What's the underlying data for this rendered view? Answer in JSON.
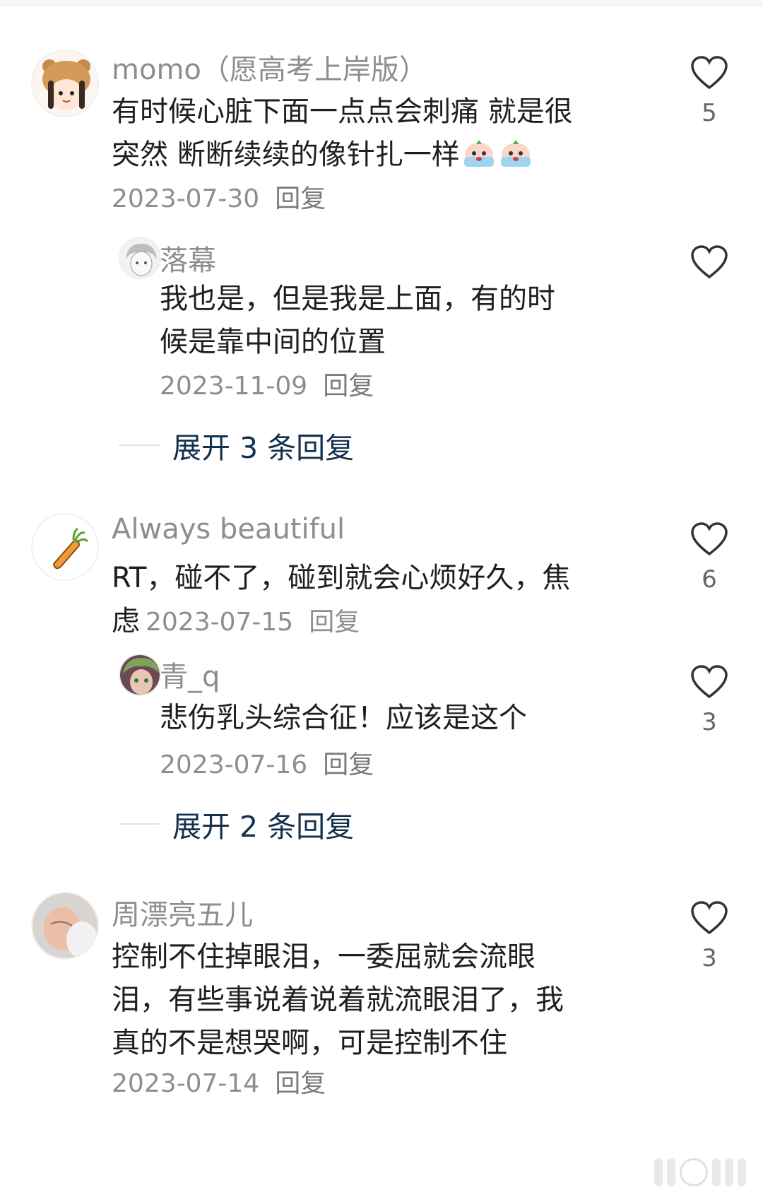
{
  "comments": [
    {
      "username": "momo（愿高考上岸版）",
      "text_line1": "有时候心脏下面一点点会刺痛 就是很",
      "text_line2": "突然 断断续续的像针扎一样",
      "date": "2023-07-30",
      "reply_label": "回复",
      "likes": "5",
      "avatar_icon": "bear-hat-girl-avatar",
      "replies": [
        {
          "username": "落幕",
          "text_line1": "我也是，但是我是上面，有的时",
          "text_line2": "候是靠中间的位置",
          "date": "2023-11-09",
          "reply_label": "回复"
        }
      ],
      "expand_label": "展开 3 条回复"
    },
    {
      "username": "Always beautiful",
      "text_line1": "RT，碰不了，碰到就会心烦好久，焦",
      "text_line2": "虑",
      "date": "2023-07-15",
      "reply_label": "回复",
      "likes": "6",
      "avatar_icon": "carrot-avatar",
      "replies": [
        {
          "username": "青_q",
          "text_line1": "悲伤乳头综合征！应该是这个",
          "date": "2023-07-16",
          "reply_label": "回复",
          "likes": "3"
        }
      ],
      "expand_label": "展开 2 条回复"
    },
    {
      "username": "周漂亮五儿",
      "text_line1": "控制不住掉眼泪，一委屈就会流眼",
      "text_line2": "泪，有些事说着说着就流眼泪了，我",
      "text_line3": "真的不是想哭啊，可是控制不住",
      "date": "2023-07-14",
      "reply_label": "回复",
      "likes": "3",
      "avatar_icon": "baby-photo-avatar"
    }
  ],
  "colors": {
    "expand_text": "#14314f",
    "muted": "#8e8e8e",
    "heart_stroke": "#333333"
  }
}
